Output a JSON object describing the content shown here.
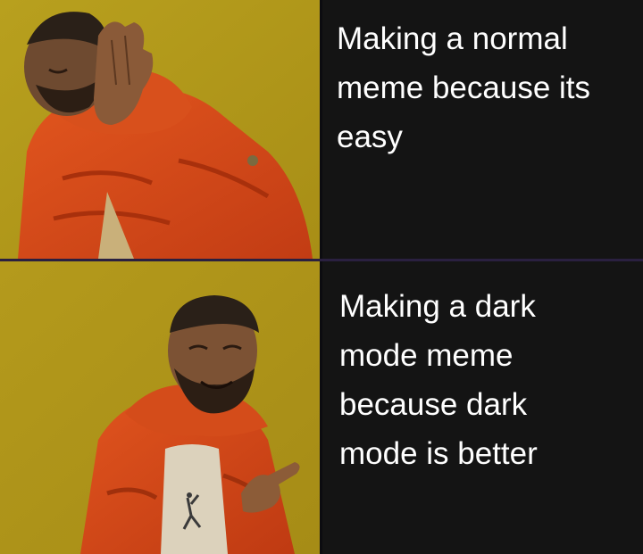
{
  "panels": [
    {
      "image_icon": "drake-disapproving-icon",
      "caption": "Making a normal\nmeme because its\neasy"
    },
    {
      "image_icon": "drake-approving-icon",
      "caption": "Making a dark\nmode meme\nbecause dark\nmode is better"
    }
  ],
  "colors": {
    "background": "#141414",
    "caption_text": "#ffffff",
    "backdrop": "#b39a1c",
    "jacket": "#d54a1c"
  }
}
